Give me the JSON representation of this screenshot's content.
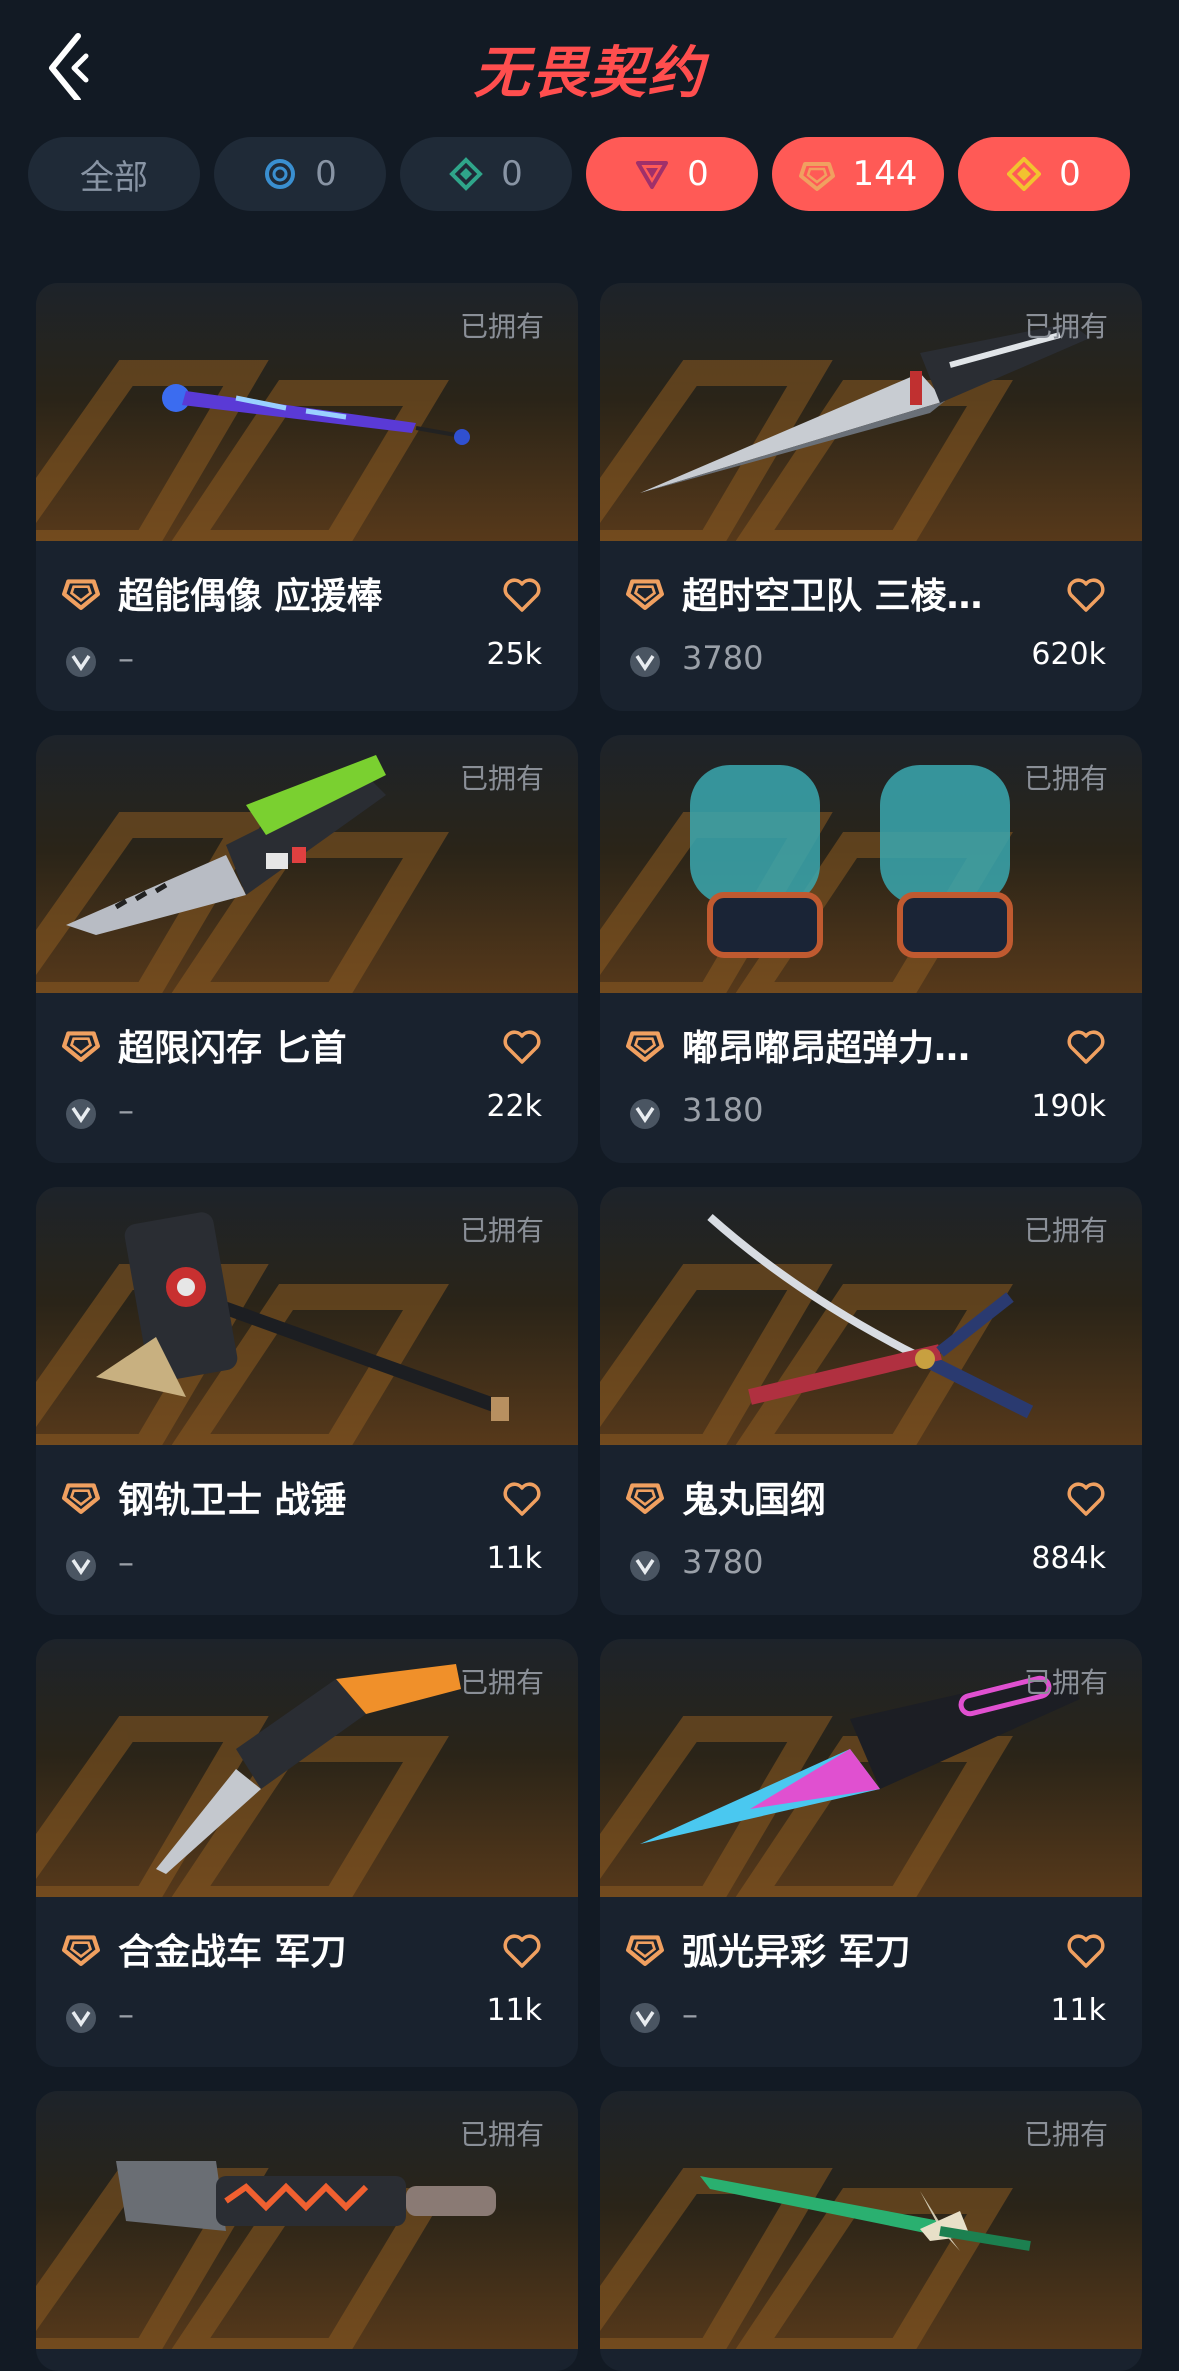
{
  "header": {
    "title": "无畏契约"
  },
  "filters": [
    {
      "label": "全部",
      "icon": "all"
    },
    {
      "label": "0",
      "icon": "select-tier-icon"
    },
    {
      "label": "0",
      "icon": "deluxe-tier-icon"
    },
    {
      "label": "0",
      "icon": "premium-tier-icon"
    },
    {
      "label": "144",
      "icon": "exclusive-tier-icon"
    },
    {
      "label": "0",
      "icon": "ultra-tier-icon"
    }
  ],
  "owned_label": "已拥有",
  "items": [
    {
      "name": "超能偶像 应援棒",
      "price": "–",
      "likes": "25k"
    },
    {
      "name": "超时空卫队 三棱…",
      "price": "3780",
      "likes": "620k"
    },
    {
      "name": "超限闪存 匕首",
      "price": "–",
      "likes": "22k"
    },
    {
      "name": "嘟昂嘟昂超弹力…",
      "price": "3180",
      "likes": "190k"
    },
    {
      "name": "钢轨卫士 战锤",
      "price": "–",
      "likes": "11k"
    },
    {
      "name": "鬼丸国纲",
      "price": "3780",
      "likes": "884k"
    },
    {
      "name": "合金战车 军刀",
      "price": "–",
      "likes": "11k"
    },
    {
      "name": "弧光异彩 军刀",
      "price": "–",
      "likes": "11k"
    },
    {
      "name": "",
      "price": "",
      "likes": ""
    },
    {
      "name": "",
      "price": "",
      "likes": ""
    }
  ],
  "colors": {
    "background": "#121a24",
    "accent": "#ff5a56",
    "tier_orange": "#f0a060",
    "card": "#19222e"
  }
}
